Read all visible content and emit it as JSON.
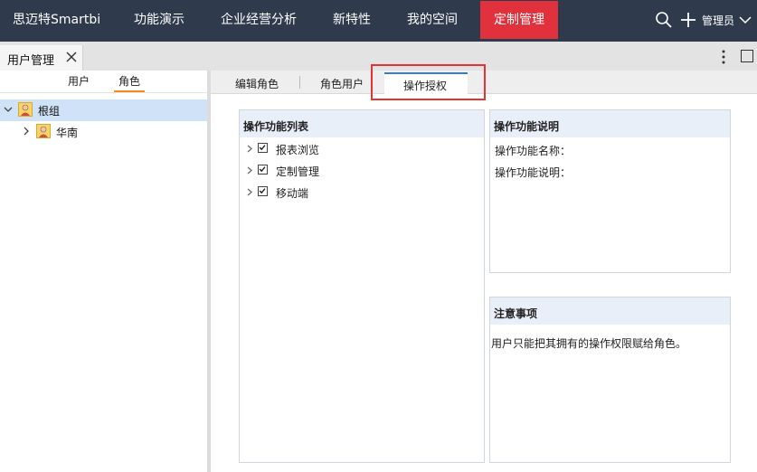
{
  "nav": {
    "brand": "思迈特Smartbi",
    "items": [
      "功能演示",
      "企业经营分析",
      "新特性",
      "我的空间",
      "定制管理"
    ],
    "active_index": 4,
    "admin_label": "管理员"
  },
  "tabs": {
    "open_tab_label": "用户管理"
  },
  "left_panel": {
    "tabs": [
      "用户",
      "角色"
    ],
    "active_tab": "角色",
    "tree": [
      {
        "label": "根组",
        "selected": true
      },
      {
        "label": "华南",
        "selected": false
      }
    ]
  },
  "right_panel": {
    "subtabs": [
      "编辑角色",
      "角色用户",
      "操作授权"
    ],
    "active_subtab": "操作授权",
    "function_list": {
      "title": "操作功能列表",
      "items": [
        {
          "label": "报表浏览",
          "checked": true
        },
        {
          "label": "定制管理",
          "checked": true
        },
        {
          "label": "移动端",
          "checked": true
        }
      ]
    },
    "description": {
      "title": "操作功能说明",
      "name_label": "操作功能名称：",
      "desc_label": "操作功能说明："
    },
    "notes": {
      "title": "注意事项",
      "text": "用户只能把其拥有的操作权限赋给角色。"
    }
  },
  "colors": {
    "topbar": "#2f3a4d",
    "active_nav": "#e0313d",
    "highlight_border": "#e53333",
    "selected_row": "#cfe2f7",
    "tab_underline": "#f28c1e"
  }
}
